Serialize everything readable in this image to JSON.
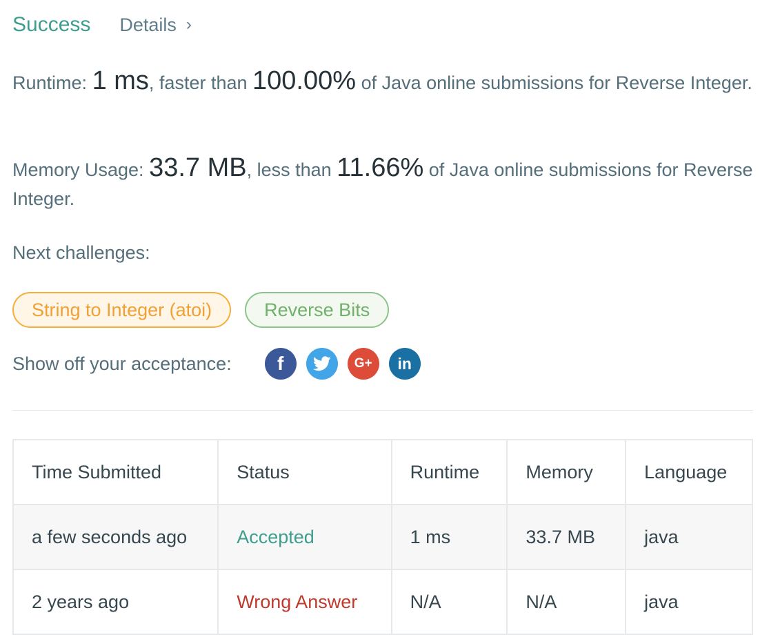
{
  "header": {
    "title": "Success",
    "details_label": "Details",
    "details_chevron": "›"
  },
  "runtime": {
    "label": "Runtime:",
    "value": "1 ms",
    "mid": ", faster than",
    "percent": "100.00%",
    "tail": "of Java online submissions for Reverse Integer."
  },
  "memory": {
    "label": "Memory Usage:",
    "value": "33.7 MB",
    "mid": ", less than",
    "percent": "11.66%",
    "tail": "of Java online submissions for Reverse Integer."
  },
  "next": {
    "label": "Next challenges:",
    "items": [
      {
        "label": "String to Integer (atoi)",
        "color": "#f0a035"
      },
      {
        "label": "Reverse Bits",
        "color": "#6fb06a"
      }
    ]
  },
  "share": {
    "label": "Show off your acceptance:",
    "icons": [
      {
        "name": "facebook-icon",
        "glyph": "f",
        "color": "#3b5998"
      },
      {
        "name": "twitter-icon",
        "glyph": "",
        "color": "#42a5e8"
      },
      {
        "name": "google-plus-icon",
        "glyph": "G+",
        "color": "#dd4b39"
      },
      {
        "name": "linkedin-icon",
        "glyph": "in",
        "color": "#1a6fa3"
      }
    ]
  },
  "table": {
    "headers": [
      "Time Submitted",
      "Status",
      "Runtime",
      "Memory",
      "Language"
    ],
    "rows": [
      {
        "time": "a few seconds ago",
        "status": "Accepted",
        "runtime": "1 ms",
        "memory": "33.7 MB",
        "language": "java"
      },
      {
        "time": "2 years ago",
        "status": "Wrong Answer",
        "runtime": "N/A",
        "memory": "N/A",
        "language": "java"
      }
    ]
  },
  "colors": {
    "success": "#3e9e8e",
    "wrong": "#c0392b",
    "text": "#546e7a"
  }
}
